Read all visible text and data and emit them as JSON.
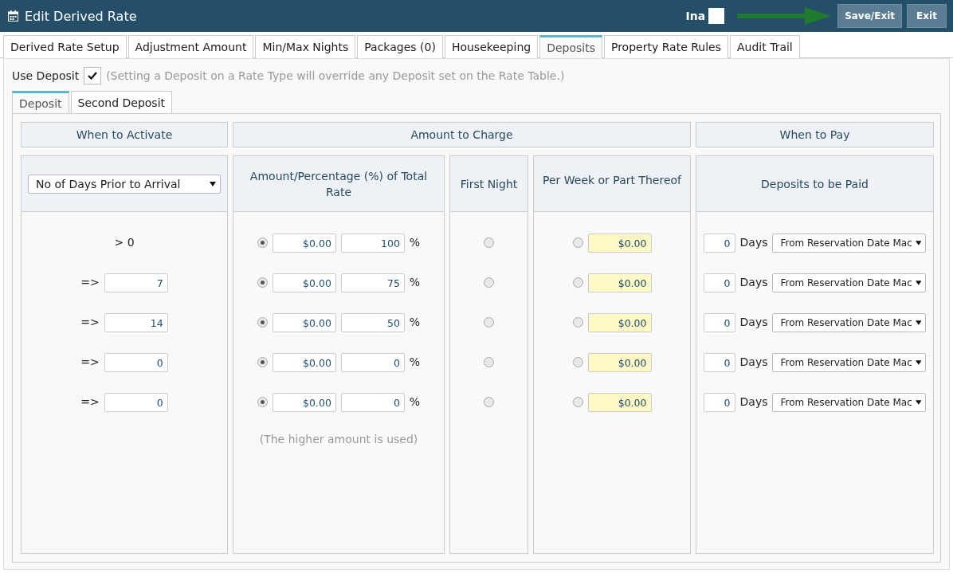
{
  "window": {
    "title": "Edit Derived Rate"
  },
  "header": {
    "inactive_label": "Ina",
    "inactive_checked": false,
    "buttons": [
      {
        "label": "Save/Exit"
      },
      {
        "label": "Exit"
      }
    ]
  },
  "tabs": [
    {
      "label": "Derived Rate Setup",
      "selected": false
    },
    {
      "label": "Adjustment Amount",
      "selected": false
    },
    {
      "label": "Min/Max Nights",
      "selected": false
    },
    {
      "label": "Packages (0)",
      "selected": false
    },
    {
      "label": "Housekeeping",
      "selected": false
    },
    {
      "label": "Deposits",
      "selected": true
    },
    {
      "label": "Property Rate Rules",
      "selected": false
    },
    {
      "label": "Audit Trail",
      "selected": false
    }
  ],
  "use_deposit": {
    "label": "Use Deposit",
    "checked": true,
    "note": "(Setting a Deposit on a Rate Type will override any Deposit set on the Rate Table.)"
  },
  "sub_tabs": [
    {
      "label": "Deposit",
      "selected": true
    },
    {
      "label": "Second Deposit",
      "selected": false
    }
  ],
  "groups": [
    "When to Activate",
    "Amount to Charge",
    "When to Pay"
  ],
  "columns": {
    "activate_select": "No of Days Prior to Arrival",
    "amount": "Amount/Percentage (%) of Total Rate",
    "first_night": "First Night",
    "per_week": "Per Week or Part Thereof",
    "deposits": "Deposits to be Paid"
  },
  "rows": [
    {
      "operator": "> 0",
      "days": null,
      "amount_selected": true,
      "amount": "$0.00",
      "percent": "100",
      "percent_sign": "%",
      "first_night_selected": false,
      "per_week_selected": false,
      "per_week": "$0.00",
      "pay_days": "0",
      "days_label": "Days",
      "pay_from": "From Reservation Date Mac"
    },
    {
      "operator": "=>",
      "days": "7",
      "amount_selected": true,
      "amount": "$0.00",
      "percent": "75",
      "percent_sign": "%",
      "first_night_selected": false,
      "per_week_selected": false,
      "per_week": "$0.00",
      "pay_days": "0",
      "days_label": "Days",
      "pay_from": "From Reservation Date Mac"
    },
    {
      "operator": "=>",
      "days": "14",
      "amount_selected": true,
      "amount": "$0.00",
      "percent": "50",
      "percent_sign": "%",
      "first_night_selected": false,
      "per_week_selected": false,
      "per_week": "$0.00",
      "pay_days": "0",
      "days_label": "Days",
      "pay_from": "From Reservation Date Mac"
    },
    {
      "operator": "=>",
      "days": "0",
      "amount_selected": true,
      "amount": "$0.00",
      "percent": "0",
      "percent_sign": "%",
      "first_night_selected": false,
      "per_week_selected": false,
      "per_week": "$0.00",
      "pay_days": "0",
      "days_label": "Days",
      "pay_from": "From Reservation Date Mac"
    },
    {
      "operator": "=>",
      "days": "0",
      "amount_selected": true,
      "amount": "$0.00",
      "percent": "0",
      "percent_sign": "%",
      "first_night_selected": false,
      "per_week_selected": false,
      "per_week": "$0.00",
      "pay_days": "0",
      "days_label": "Days",
      "pay_from": "From Reservation Date Mac"
    }
  ],
  "amount_note": "(The higher amount is used)"
}
